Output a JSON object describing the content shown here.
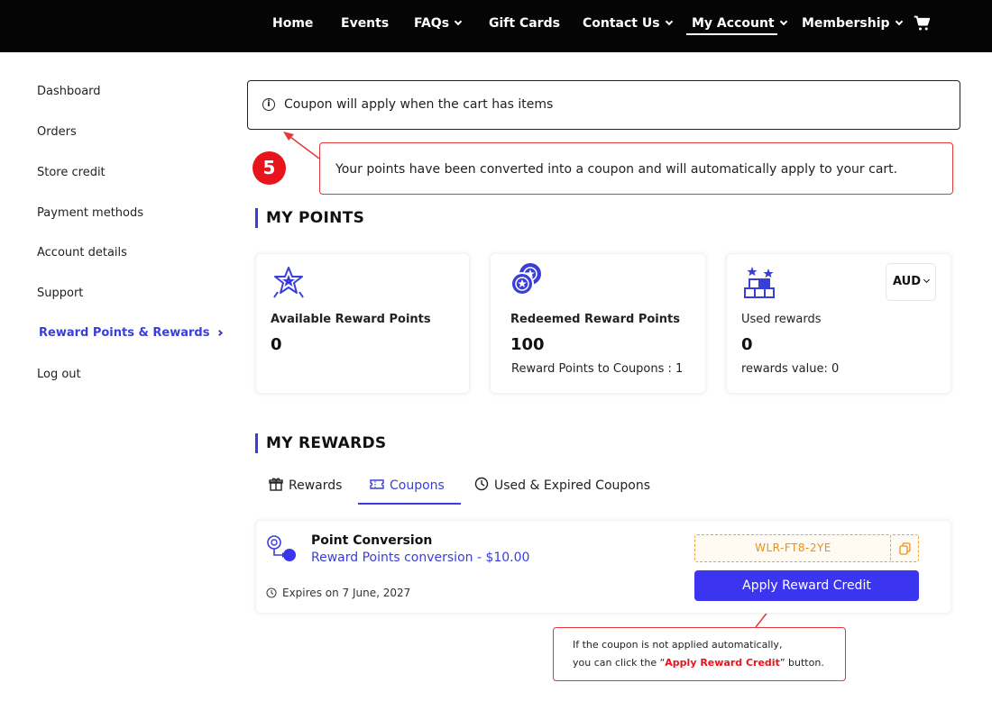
{
  "nav": {
    "items": [
      {
        "label": "Home",
        "has_dropdown": false
      },
      {
        "label": "Events",
        "has_dropdown": false
      },
      {
        "label": "FAQs",
        "has_dropdown": true
      },
      {
        "label": "Gift Cards",
        "has_dropdown": false
      },
      {
        "label": "Contact Us",
        "has_dropdown": true
      },
      {
        "label": "My Account",
        "has_dropdown": true,
        "active": true
      },
      {
        "label": "Membership",
        "has_dropdown": true
      }
    ],
    "cart_icon": "cart-icon"
  },
  "sidebar": {
    "items": [
      {
        "label": "Dashboard"
      },
      {
        "label": "Orders"
      },
      {
        "label": "Store credit"
      },
      {
        "label": "Payment methods"
      },
      {
        "label": "Account details"
      },
      {
        "label": "Support"
      },
      {
        "label": "Reward Points & Rewards",
        "active": true
      },
      {
        "label": "Log out"
      }
    ]
  },
  "notice": {
    "icon": "info-icon",
    "text": "Coupon will apply when the cart has items"
  },
  "annotations": {
    "step_number": "5",
    "callout_main": "Your points have been converted into a coupon and will automatically apply to your cart.",
    "callout_button_line1": "If the coupon is not applied automatically,",
    "callout_button_line2_prefix": "you can click the “",
    "callout_button_highlight": "Apply Reward Credit",
    "callout_button_line2_suffix": "” button."
  },
  "points": {
    "title": "MY POINTS",
    "cards": [
      {
        "label": "Available Reward Points",
        "value": "0",
        "sub": "",
        "icon": "star-badge-icon"
      },
      {
        "label": "Redeemed Reward Points",
        "value": "100",
        "sub": "Reward Points to Coupons : 1",
        "icon": "coins-icon"
      },
      {
        "label": "Used rewards",
        "value": "0",
        "sub": "rewards value: 0",
        "icon": "gift-boxes-icon"
      }
    ],
    "currency": "AUD"
  },
  "rewards": {
    "title": "MY REWARDS",
    "tabs": [
      {
        "label": "Rewards",
        "icon": "gift-icon"
      },
      {
        "label": "Coupons",
        "icon": "ticket-icon",
        "active": true
      },
      {
        "label": "Used & Expired Coupons",
        "icon": "clock-icon"
      }
    ],
    "coupon": {
      "title": "Point Conversion",
      "description": "Reward Points conversion - $10.00",
      "expiry": "Expires on 7 June, 2027",
      "code": "WLR-FT8-2YE",
      "apply_label": "Apply Reward Credit"
    }
  },
  "colors": {
    "accent": "#3a3ed8",
    "button": "#3b35f0",
    "annotation_red": "#e8141c",
    "code_orange": "#e8901a",
    "nav_bg": "#050505"
  }
}
